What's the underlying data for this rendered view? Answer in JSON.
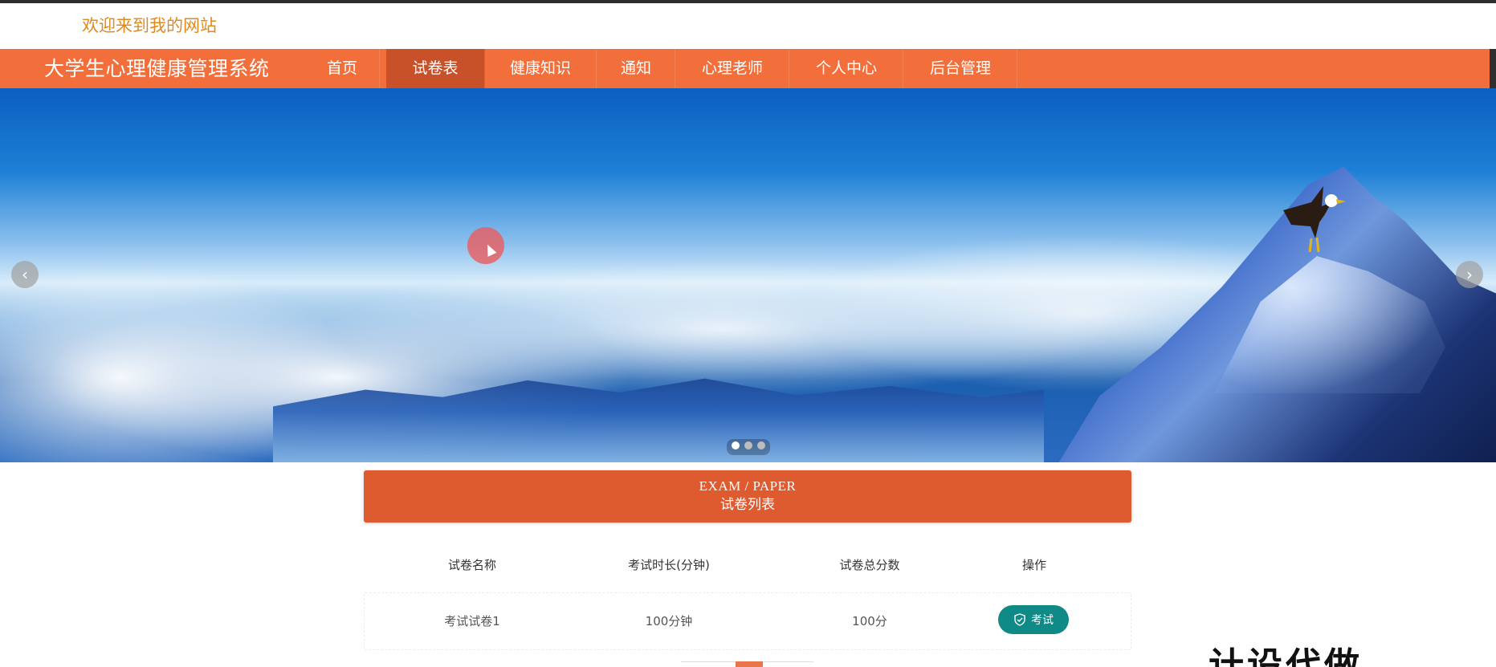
{
  "header": {
    "welcome": "欢迎来到我的网站"
  },
  "nav": {
    "site_title": "大学生心理健康管理系统",
    "items": [
      {
        "label": "首页"
      },
      {
        "label": "试卷表"
      },
      {
        "label": "健康知识"
      },
      {
        "label": "通知"
      },
      {
        "label": "心理老师"
      },
      {
        "label": "个人中心"
      },
      {
        "label": "后台管理"
      }
    ],
    "active_index": 1,
    "colors": {
      "bar": "#f26f3c",
      "active": "#c8512a"
    }
  },
  "banner": {
    "prev_icon": "chevron-left-icon",
    "next_icon": "chevron-right-icon",
    "prev_glyph": "‹",
    "next_glyph": "›",
    "slide_count": 3,
    "active_slide": 1
  },
  "section": {
    "title_en": "EXAM / PAPER",
    "title_cn": "试卷列表",
    "color": "#de5a2f"
  },
  "table": {
    "headers": [
      "试卷名称",
      "考试时长(分钟)",
      "试卷总分数",
      "操作"
    ],
    "rows": [
      {
        "name": "考试试卷1",
        "duration": "100分钟",
        "score": "100分",
        "action": "考试"
      }
    ],
    "action_icon": "shield-check-icon",
    "action_color": "#0f8a86"
  },
  "overlay": {
    "watermark": "计设代做"
  }
}
